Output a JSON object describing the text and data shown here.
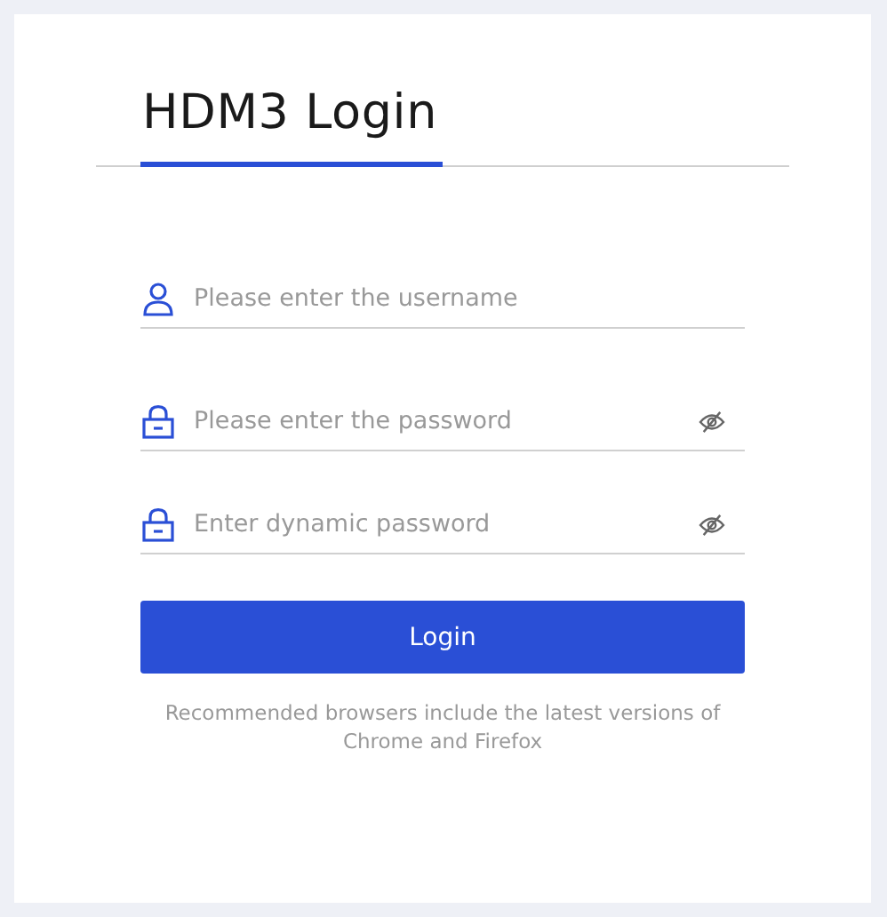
{
  "title": "HDM3 Login",
  "fields": [
    {
      "kind": "user",
      "placeholder": "Please enter the username"
    },
    {
      "kind": "lock",
      "placeholder": "Please enter the password",
      "password_visible": false
    },
    {
      "kind": "lock",
      "placeholder": "Enter dynamic password",
      "password_visible": false
    }
  ],
  "login_button": "Login",
  "note": "Recommended browsers include the latest versions of Chrome and Firefox"
}
